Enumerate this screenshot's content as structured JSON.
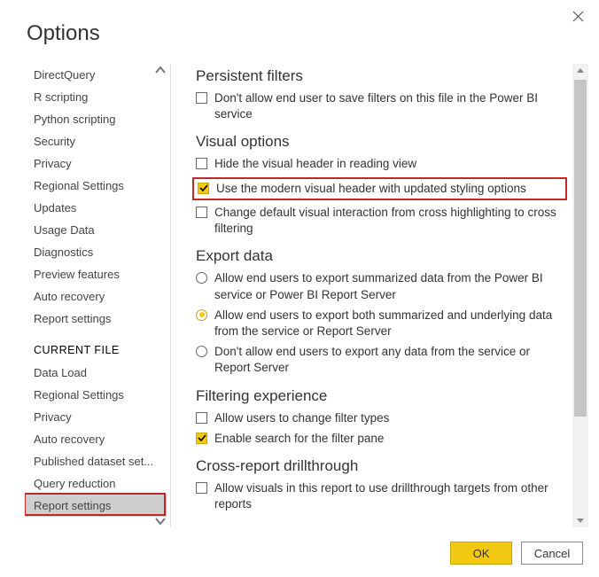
{
  "dialog": {
    "title": "Options"
  },
  "sidebar": {
    "global": [
      "DirectQuery",
      "R scripting",
      "Python scripting",
      "Security",
      "Privacy",
      "Regional Settings",
      "Updates",
      "Usage Data",
      "Diagnostics",
      "Preview features",
      "Auto recovery",
      "Report settings"
    ],
    "current_header": "CURRENT FILE",
    "current": [
      "Data Load",
      "Regional Settings",
      "Privacy",
      "Auto recovery",
      "Published dataset set...",
      "Query reduction",
      "Report settings"
    ],
    "selected": "Report settings"
  },
  "sections": {
    "persistent": {
      "title": "Persistent filters",
      "opt1": {
        "label": "Don't allow end user to save filters on this file in the Power BI service",
        "checked": false
      }
    },
    "visual": {
      "title": "Visual options",
      "opt1": {
        "label": "Hide the visual header in reading view",
        "checked": false
      },
      "opt2": {
        "label": "Use the modern visual header with updated styling options",
        "checked": true
      },
      "opt3": {
        "label": "Change default visual interaction from cross highlighting to cross filtering",
        "checked": false
      }
    },
    "export": {
      "title": "Export data",
      "opt1": {
        "label": "Allow end users to export summarized data from the Power BI service or Power BI Report Server"
      },
      "opt2": {
        "label": "Allow end users to export both summarized and underlying data from the service or Report Server"
      },
      "opt3": {
        "label": "Don't allow end users to export any data from the service or Report Server"
      },
      "selected": 2
    },
    "filtering": {
      "title": "Filtering experience",
      "opt1": {
        "label": "Allow users to change filter types",
        "checked": false
      },
      "opt2": {
        "label": "Enable search for the filter pane",
        "checked": true
      }
    },
    "cross": {
      "title": "Cross-report drillthrough",
      "opt1": {
        "label": "Allow visuals in this report to use drillthrough targets from other reports",
        "checked": false
      }
    }
  },
  "footer": {
    "ok": "OK",
    "cancel": "Cancel"
  }
}
